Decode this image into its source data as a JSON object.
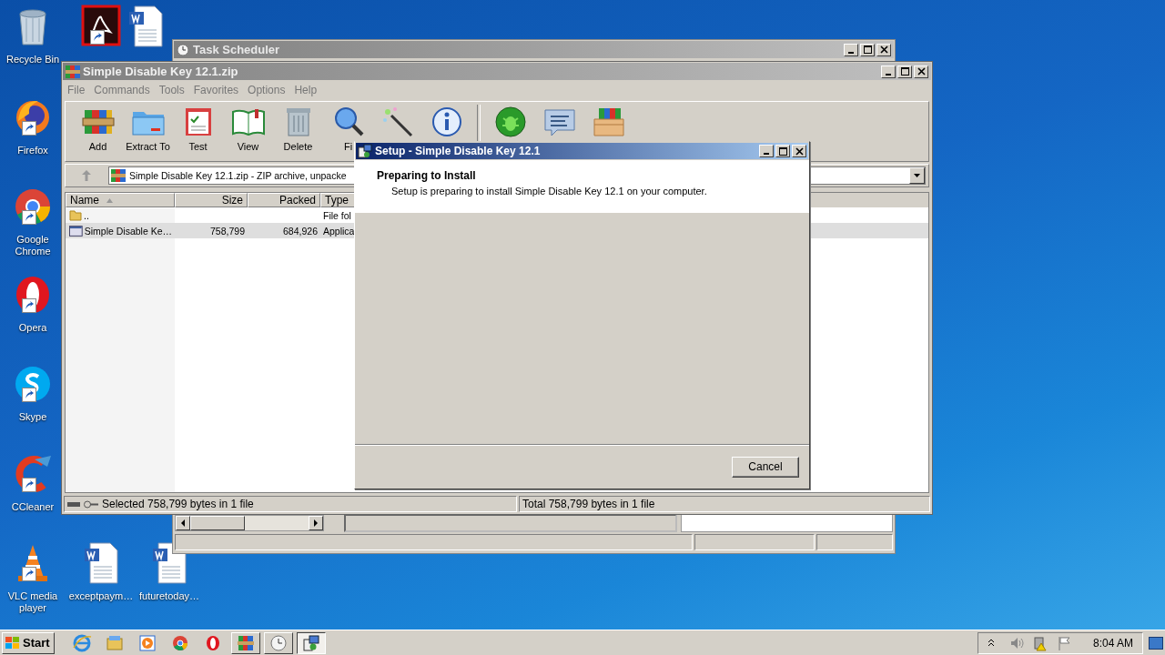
{
  "desktop": {
    "icons": [
      {
        "kind": "recycle-bin",
        "label": "Recycle Bin",
        "shortcut": false
      },
      {
        "kind": "acrobat",
        "shortcut": true
      },
      {
        "kind": "word",
        "shortcut": false
      },
      {
        "kind": "firefox",
        "label": "Firefox",
        "shortcut": true
      },
      {
        "kind": "chrome",
        "label": "Google Chrome",
        "shortcut": true
      },
      {
        "kind": "opera",
        "label": "Opera",
        "shortcut": true
      },
      {
        "kind": "skype",
        "label": "Skype",
        "shortcut": true
      },
      {
        "kind": "ccleaner",
        "label": "CCleaner",
        "shortcut": true
      },
      {
        "kind": "vlc",
        "label": "VLC media player",
        "shortcut": true
      },
      {
        "kind": "word",
        "label": "exceptpaym…",
        "shortcut": false
      },
      {
        "kind": "word",
        "label": "futuretoday…",
        "shortcut": false
      }
    ]
  },
  "task_scheduler": {
    "title": "Task Scheduler"
  },
  "winrar": {
    "title": "Simple Disable Key 12.1.zip",
    "menu": [
      "File",
      "Commands",
      "Tools",
      "Favorites",
      "Options",
      "Help"
    ],
    "toolbar": [
      {
        "kind": "add",
        "label": "Add"
      },
      {
        "kind": "extract",
        "label": "Extract To"
      },
      {
        "kind": "test",
        "label": "Test"
      },
      {
        "kind": "view",
        "label": "View"
      },
      {
        "kind": "delete",
        "label": "Delete"
      },
      {
        "kind": "find",
        "label": "Fi"
      },
      {
        "kind": "wizard"
      },
      {
        "kind": "info"
      },
      {
        "kind": "separator"
      },
      {
        "kind": "virus"
      },
      {
        "kind": "comment"
      },
      {
        "kind": "sfx"
      }
    ],
    "address": "Simple Disable Key 12.1.zip - ZIP archive, unpacke",
    "columns": [
      {
        "label": "Name",
        "sorted": true
      },
      {
        "label": "Size",
        "sorted": false
      },
      {
        "label": "Packed",
        "sorted": false
      },
      {
        "label": "Type",
        "sorted": false
      }
    ],
    "rows": [
      {
        "kind": "folder",
        "name": "..",
        "type": "File fol",
        "selected": false
      },
      {
        "kind": "app",
        "name": "Simple Disable Ke…",
        "size": "758,799",
        "packed": "684,926",
        "type": "Applica",
        "selected": true
      }
    ],
    "status": [
      "Selected 758,799 bytes in 1 file",
      "Total 758,799 bytes in 1 file"
    ]
  },
  "setup": {
    "title": "Setup - Simple Disable Key 12.1",
    "heading": "Preparing to Install",
    "description": "Setup is preparing to install Simple Disable Key 12.1 on your computer.",
    "buttons": [
      "Cancel"
    ]
  },
  "taskbar": {
    "start": "Start",
    "items": [
      {
        "kind": "ie",
        "open": false,
        "selected": false
      },
      {
        "kind": "explorer",
        "open": false,
        "selected": false
      },
      {
        "kind": "media",
        "open": false,
        "selected": false
      },
      {
        "kind": "chrome",
        "open": false,
        "selected": false
      },
      {
        "kind": "opera",
        "open": false,
        "selected": false
      },
      {
        "kind": "winrar",
        "open": true,
        "selected": false
      },
      {
        "kind": "clock",
        "open": true,
        "selected": false
      },
      {
        "kind": "setup",
        "open": true,
        "selected": true
      }
    ],
    "clock": "8:04 AM"
  }
}
